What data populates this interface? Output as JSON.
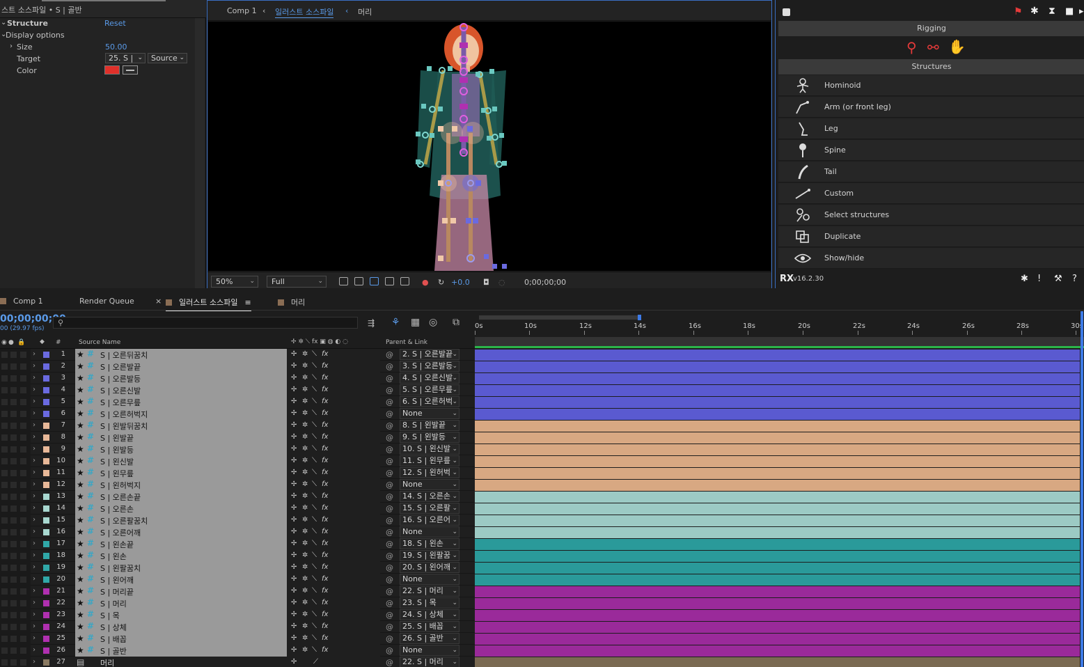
{
  "effect_controls": {
    "title": "스트 소스파일 • S | 골반",
    "structure_label": "Structure",
    "reset_label": "Reset",
    "display_options_label": "Display options",
    "size_label": "Size",
    "size_value": "50.00",
    "target_label": "Target",
    "target_value": "25. S | ",
    "target_source": "Source",
    "color_label": "Color",
    "color_value": "#e0302a"
  },
  "viewer": {
    "breadcrumbs": [
      "Comp 1",
      "일러스트 소스파일",
      "머리"
    ],
    "zoom": "50%",
    "resolution": "Full",
    "exposure": "+0.0",
    "timecode": "0;00;00;00"
  },
  "duik": {
    "rigging_label": "Rigging",
    "structures_label": "Structures",
    "items": [
      {
        "label": "Hominoid",
        "icon": "hominoid-icon"
      },
      {
        "label": "Arm (or front leg)",
        "icon": "arm-icon"
      },
      {
        "label": "Leg",
        "icon": "leg-icon"
      },
      {
        "label": "Spine",
        "icon": "spine-icon"
      },
      {
        "label": "Tail",
        "icon": "tail-icon"
      },
      {
        "label": "Custom",
        "icon": "custom-bone-icon"
      },
      {
        "label": "Select structures",
        "icon": "select-structures-icon"
      },
      {
        "label": "Duplicate",
        "icon": "duplicate-icon"
      },
      {
        "label": "Show/hide",
        "icon": "show-hide-icon"
      }
    ],
    "version": "v16.2.30",
    "accent": "#e53a3a"
  },
  "timeline": {
    "tabs": [
      "Comp 1",
      "Render Queue",
      "일러스트 소스파일",
      "머리"
    ],
    "timecode": "00;00;00;00",
    "fps": "00 (29.97 fps)",
    "col_hash": "#",
    "col_source_name": "Source Name",
    "col_parent": "Parent & Link",
    "ruler_ticks": [
      "0s",
      "10s",
      "12s",
      "14s",
      "16s",
      "18s",
      "20s",
      "22s",
      "24s",
      "26s",
      "28s",
      "30s"
    ],
    "layers": [
      {
        "n": "1",
        "name": "S | 오른뒤꿈치",
        "parent": "2. S | 오른발끝",
        "color": "#6a6ae0"
      },
      {
        "n": "2",
        "name": "S | 오른발끝",
        "parent": "3. S | 오른발등",
        "color": "#6a6ae0"
      },
      {
        "n": "3",
        "name": "S | 오른발등",
        "parent": "4. S | 오른신발",
        "color": "#6a6ae0"
      },
      {
        "n": "4",
        "name": "S | 오른신발",
        "parent": "5. S | 오른무릎",
        "color": "#6a6ae0"
      },
      {
        "n": "5",
        "name": "S | 오른무릎",
        "parent": "6. S | 오른허벅",
        "color": "#6a6ae0"
      },
      {
        "n": "6",
        "name": "S | 오른허벅지",
        "parent": "None",
        "color": "#6a6ae0"
      },
      {
        "n": "7",
        "name": "S | 왼발뒤꿈치",
        "parent": "8. S | 왼발끝",
        "color": "#e8b898"
      },
      {
        "n": "8",
        "name": "S | 왼발끝",
        "parent": "9. S | 왼발등",
        "color": "#e8b898"
      },
      {
        "n": "9",
        "name": "S | 왼발등",
        "parent": "10. S | 왼신발",
        "color": "#e8b898"
      },
      {
        "n": "10",
        "name": "S | 왼신발",
        "parent": "11. S | 왼무릎",
        "color": "#e8b898"
      },
      {
        "n": "11",
        "name": "S | 왼무릎",
        "parent": "12. S | 왼허벅",
        "color": "#e8b898"
      },
      {
        "n": "12",
        "name": "S | 왼허벅지",
        "parent": "None",
        "color": "#e8b898"
      },
      {
        "n": "13",
        "name": "S | 오른손끝",
        "parent": "14. S | 오른손",
        "color": "#a8d8d0"
      },
      {
        "n": "14",
        "name": "S | 오른손",
        "parent": "15. S | 오른팔",
        "color": "#a8d8d0"
      },
      {
        "n": "15",
        "name": "S | 오른팔꿈치",
        "parent": "16. S | 오른어",
        "color": "#a8d8d0"
      },
      {
        "n": "16",
        "name": "S | 오른어깨",
        "parent": "None",
        "color": "#a8d8d0"
      },
      {
        "n": "17",
        "name": "S | 왼손끝",
        "parent": "18. S | 왼손",
        "color": "#30a8a8"
      },
      {
        "n": "18",
        "name": "S | 왼손",
        "parent": "19. S | 왼팔꿈",
        "color": "#30a8a8"
      },
      {
        "n": "19",
        "name": "S | 왼팔꿈치",
        "parent": "20. S | 왼어깨",
        "color": "#30a8a8"
      },
      {
        "n": "20",
        "name": "S | 왼어깨",
        "parent": "None",
        "color": "#30a8a8"
      },
      {
        "n": "21",
        "name": "S | 머리끝",
        "parent": "22. S | 머리",
        "color": "#b030b0"
      },
      {
        "n": "22",
        "name": "S | 머리",
        "parent": "23. S | 목",
        "color": "#b030b0"
      },
      {
        "n": "23",
        "name": "S | 목",
        "parent": "24. S | 상체",
        "color": "#b030b0"
      },
      {
        "n": "24",
        "name": "S | 상체",
        "parent": "25. S | 배꼽",
        "color": "#b030b0"
      },
      {
        "n": "25",
        "name": "S | 배꼽",
        "parent": "26. S | 골반",
        "color": "#b030b0"
      },
      {
        "n": "26",
        "name": "S | 골반",
        "parent": "None",
        "color": "#b030b0"
      },
      {
        "n": "27",
        "name": "머리",
        "parent": "22. S | 머리",
        "color": "#8a7a62",
        "comp": true
      }
    ],
    "track_colors": {
      "#6a6ae0": "#5a5ad0",
      "#e8b898": "#d8a882",
      "#a8d8d0": "#9ccac4",
      "#30a8a8": "#2a9a9a",
      "#b030b0": "#9a2a9a",
      "#8a7a62": "#7a6a52"
    }
  }
}
